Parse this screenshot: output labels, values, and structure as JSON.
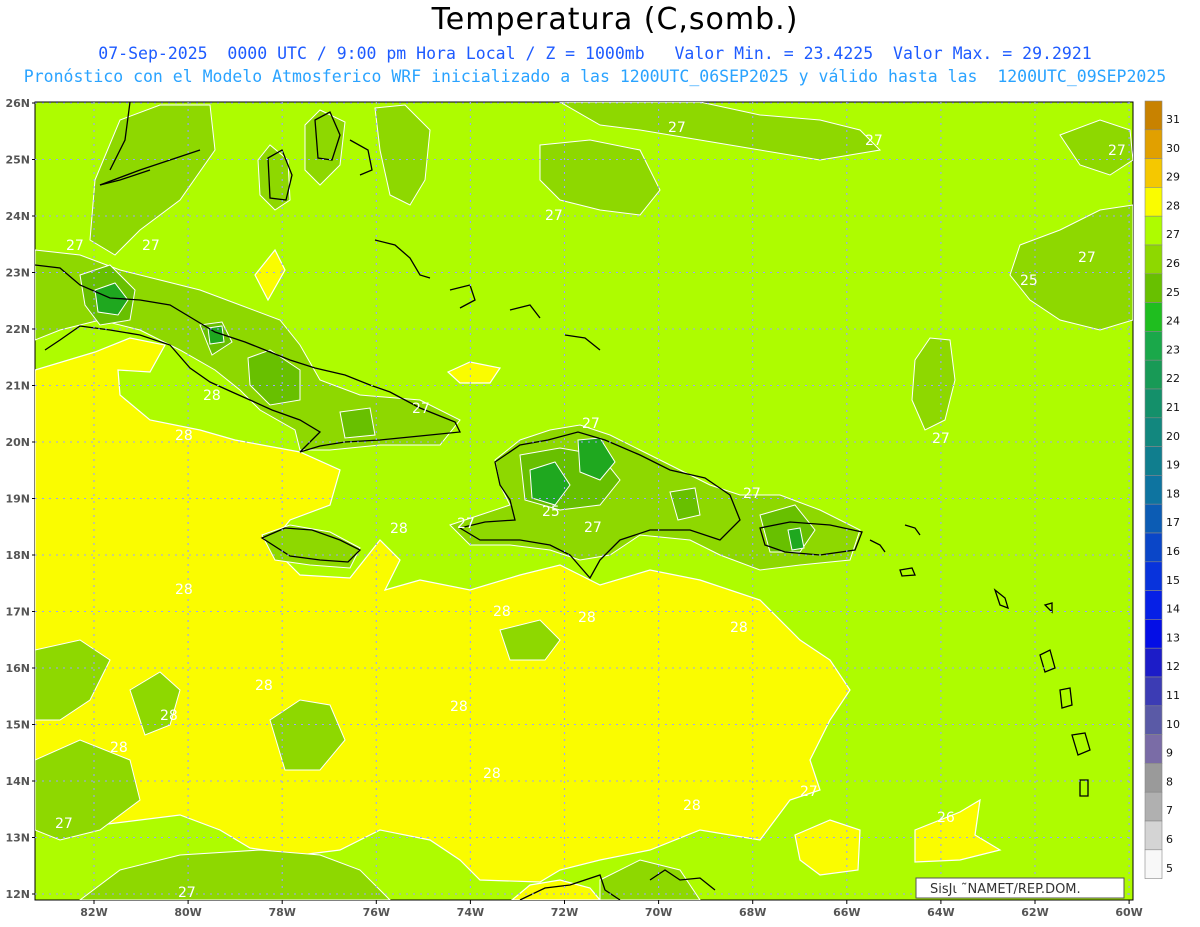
{
  "header": {
    "title": "Temperatura (C,somb.)",
    "line1": "07-Sep-2025  0000 UTC / 9:00 pm Hora Local / Z = 1000mb   Valor Min. = 23.4225  Valor Max. = 29.2921",
    "line2": "Pronóstico con el Modelo Atmosferico WRF inicializado a las 1200UTC_06SEP2025 y válido hasta las  1200UTC_09SEP2025"
  },
  "map": {
    "lat_labels": [
      "26N",
      "25N",
      "24N",
      "23N",
      "22N",
      "21N",
      "20N",
      "19N",
      "18N",
      "17N",
      "16N",
      "15N",
      "14N",
      "13N",
      "12N"
    ],
    "lon_labels": [
      "82W",
      "80W",
      "78W",
      "76W",
      "74W",
      "72W",
      "70W",
      "68W",
      "66W",
      "64W",
      "62W",
      "60W"
    ],
    "credit": "SisJι   ˜NAMET/REP.DOM.",
    "contour_labels": [
      "27",
      "27",
      "27",
      "27",
      "27",
      "27",
      "28",
      "28",
      "28",
      "28",
      "28",
      "28",
      "28",
      "28",
      "28",
      "28",
      "28",
      "28",
      "28",
      "27",
      "27",
      "26",
      "25",
      "27",
      "27",
      "27",
      "27",
      "27",
      "27"
    ],
    "colors": {
      "ocean_27": "#aefc00",
      "warm_28": "#fafc00",
      "cool_26": "#8ed800",
      "cool_25": "#68c000",
      "cool_24": "#1fa81f",
      "grid": "#9aa0ff",
      "coast": "#000000"
    }
  },
  "colorbar": {
    "labels": [
      "31",
      "30",
      "29",
      "28",
      "27",
      "26",
      "25",
      "24",
      "23",
      "22",
      "21",
      "20",
      "19",
      "18",
      "17",
      "16",
      "15",
      "14",
      "13",
      "12",
      "11",
      "10",
      "9",
      "8",
      "7",
      "6",
      "5"
    ],
    "colors": [
      "#c88200",
      "#e1a000",
      "#f5c800",
      "#fafc00",
      "#aefc00",
      "#8ed800",
      "#68c000",
      "#1fbe1f",
      "#1aa84a",
      "#189a56",
      "#14906a",
      "#12877e",
      "#107e8e",
      "#0e74a0",
      "#0c5cb4",
      "#0a46c8",
      "#0833dc",
      "#0620e6",
      "#040ee6",
      "#1c1cc8",
      "#3c3cb4",
      "#5a5aa6",
      "#7a6ca6",
      "#9a9a9a",
      "#b0b0b0",
      "#d4d4d4",
      "#f8f8f8"
    ]
  }
}
